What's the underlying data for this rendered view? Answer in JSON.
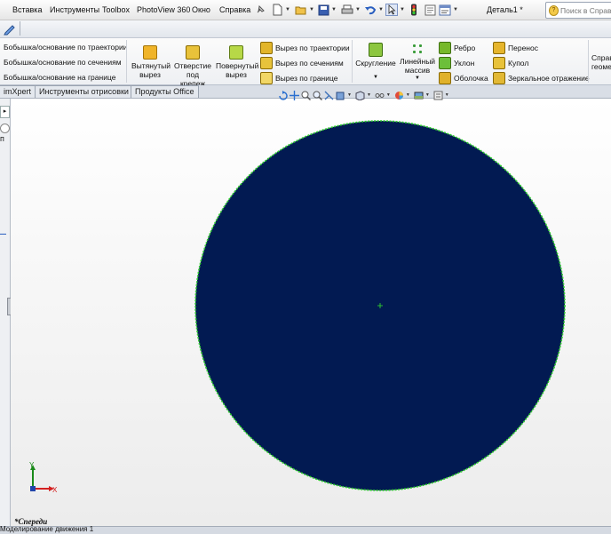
{
  "menu": {
    "items": [
      "Вставка",
      "Инструменты",
      "Toolbox",
      "PhotoView 360",
      "Окно",
      "Справка"
    ]
  },
  "document": {
    "title": "Деталь1 *"
  },
  "search": {
    "placeholder": "Поиск в Справке"
  },
  "features": {
    "boss_sweep": "Бобышка/основание по траектории",
    "boss_loft": "Бобышка/основание по сечениям",
    "boss_boundary": "Бобышка/основание на границе",
    "extruded_cut": "Вытянутый вырез",
    "hole_wizard": "Отверстие под крепеж",
    "revolved_cut": "Повернутый вырез",
    "swept_cut": "Вырез по траектории",
    "lofted_cut": "Вырез по сечениям",
    "boundary_cut": "Вырез по границе",
    "fillet": "Скругление",
    "linear_pattern": "Линейный массив",
    "rib": "Ребро",
    "draft": "Уклон",
    "shell": "Оболочка",
    "wrap": "Перенос",
    "dome": "Купол",
    "mirror": "Зеркальное отражение",
    "ref_geometry": "Справочная геометрия"
  },
  "tabs": [
    "imXpert",
    "Инструменты отрисовки",
    "Продукты Office"
  ],
  "view": {
    "orientation_label": "*Спереди",
    "bottom_tab": "Моделирование движения 1"
  },
  "triad": {
    "x_label": "X",
    "y_label": "Y"
  },
  "colors": {
    "circle_fill": "#021a52",
    "circle_edge": "#2ecf2e",
    "axis_x": "#d42020",
    "axis_y": "#1a8a1a"
  }
}
